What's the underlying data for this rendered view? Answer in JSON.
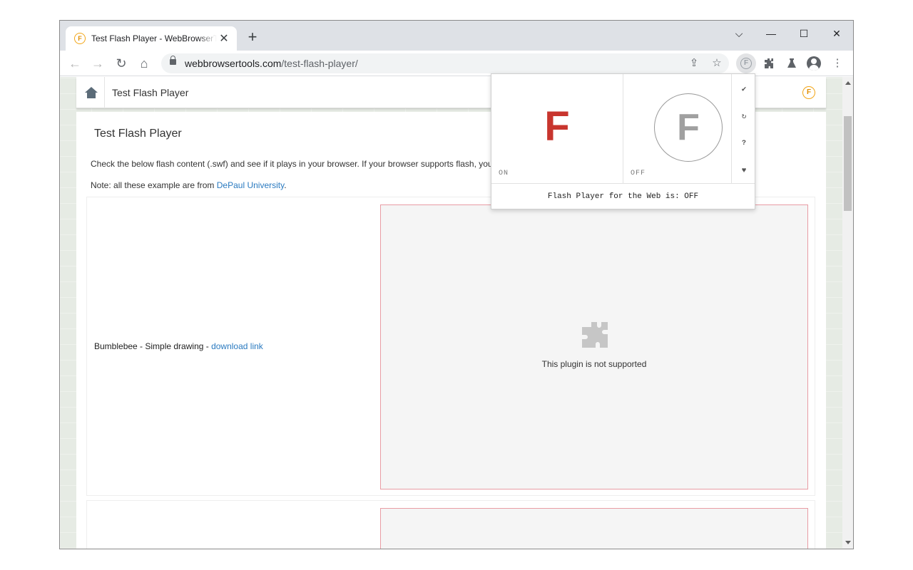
{
  "browser": {
    "tab": {
      "title": "Test Flash Player - WebBrowserTools",
      "favicon_letter": "F"
    },
    "new_tab_label": "+",
    "window_controls": {
      "dropdown": "⌵",
      "minimize": "—",
      "maximize": "☐",
      "close": "✕"
    },
    "url": {
      "domain": "webbrowsertools.com",
      "path": "/test-flash-player/"
    },
    "extension_letter": "F"
  },
  "site": {
    "header_title": "Test Flash Player",
    "favicon_letter": "F"
  },
  "page": {
    "heading": "Test Flash Player",
    "description": "Check the below flash content (.swf) and see if it plays in your browser. If your browser supports flash, you should see the animations.",
    "note_prefix": "Note: all these example are from ",
    "note_link": "DePaul University",
    "note_suffix": ".",
    "items": [
      {
        "label_prefix": "Bumblebee - Simple drawing - ",
        "link": "download link",
        "plugin_message": "This plugin is not supported"
      }
    ]
  },
  "popup": {
    "on_letter": "F",
    "off_letter": "F",
    "on_label": "ON",
    "off_label": "OFF",
    "status": "Flash Player for the Web is: OFF",
    "side_icons": [
      "check-icon",
      "refresh-icon",
      "help-icon",
      "heart-icon"
    ]
  },
  "colors": {
    "on_red": "#c8352e",
    "off_gray": "#a0a0a0",
    "link": "#2a7ac0",
    "favicon_orange": "#f2a516"
  }
}
